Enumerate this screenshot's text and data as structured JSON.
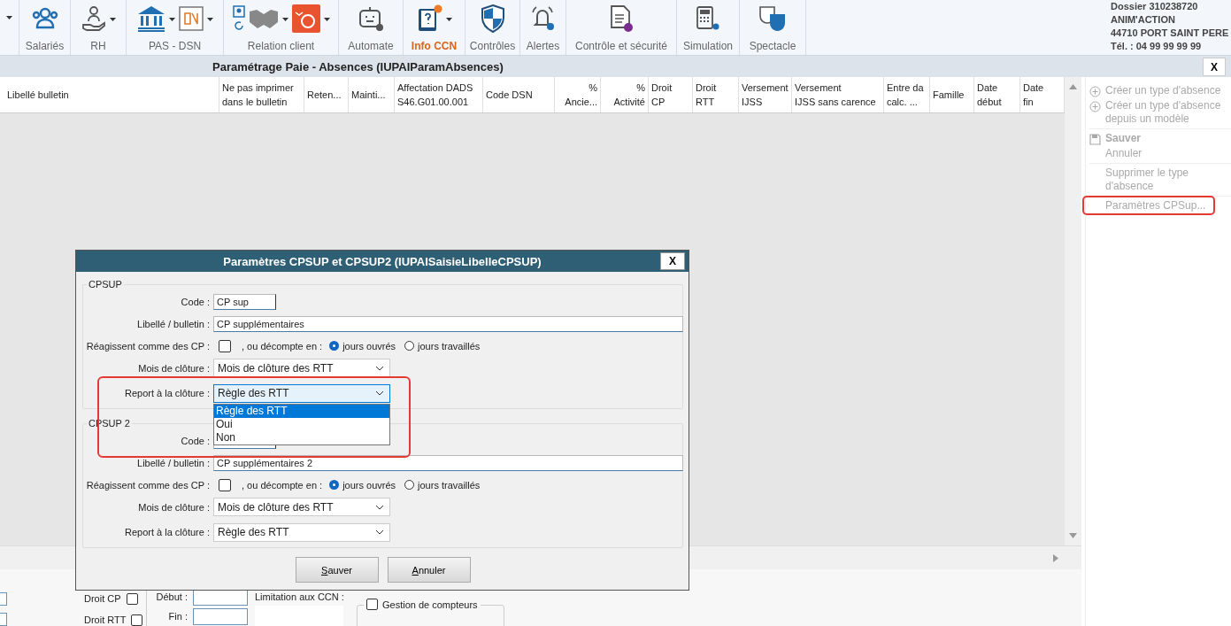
{
  "toolbar": {
    "groups": [
      {
        "label": "Salariés",
        "selected": false
      },
      {
        "label": "RH",
        "selected": false
      },
      {
        "label": "PAS - DSN",
        "selected": false
      },
      {
        "label": "Relation client",
        "selected": false
      },
      {
        "label": "Automate",
        "selected": false
      },
      {
        "label": "Info CCN",
        "selected": true
      },
      {
        "label": "Contrôles",
        "selected": false
      },
      {
        "label": "Alertes",
        "selected": false
      },
      {
        "label": "Contrôle et sécurité",
        "selected": false
      },
      {
        "label": "Simulation",
        "selected": false
      },
      {
        "label": "Spectacle",
        "selected": false
      }
    ],
    "dossier": [
      "Dossier 310238720",
      "ANIM'ACTION",
      "44710 PORT SAINT PERE",
      "Tél. : 04 99 99 99 99"
    ]
  },
  "window": {
    "title": "Paramétrage Paie - Absences (IUPAIParamAbsences)",
    "close": "X"
  },
  "table": {
    "columns": [
      "Libellé bulletin",
      "Ne pas imprimer\ndans le bulletin",
      "Reten...",
      "Mainti...",
      "Affectation DADS\nS46.G01.00.001",
      "Code DSN",
      "%\nAncie...",
      "%\nActivité",
      "Droit\nCP",
      "Droit\nRTT",
      "Versement\nIJSS",
      "Versement\nIJSS sans carence",
      "Entre da\ncalc. ...",
      "Famille",
      "Date\ndébut",
      "Date\nfin"
    ]
  },
  "sidebar": {
    "groups": [
      [
        {
          "label": "Créer un type d'absence",
          "kind": "create",
          "disabled": true,
          "highlighted": false
        },
        {
          "label": "Créer un type d'absence depuis un modèle",
          "kind": "create",
          "disabled": true,
          "highlighted": false
        }
      ],
      [
        {
          "label": "Sauver",
          "kind": "save",
          "disabled": true,
          "highlighted": false
        },
        {
          "label": "Annuler",
          "kind": "plain",
          "disabled": true,
          "highlighted": false
        }
      ],
      [
        {
          "label": "Supprimer le type d'absence",
          "kind": "plain",
          "disabled": true,
          "highlighted": false
        }
      ],
      [
        {
          "label": "Paramètres CPSup...",
          "kind": "plain",
          "disabled": true,
          "highlighted": true
        }
      ]
    ]
  },
  "dialog": {
    "title": "Paramètres CPSUP et CPSUP2 (IUPAISaisieLibelleCPSUP)",
    "close": "X",
    "sections": [
      {
        "legend": "CPSUP",
        "code_label": "Code :",
        "code_value": "CP sup",
        "libelle_label": "Libellé / bulletin :",
        "libelle_value": "CP supplémentaires",
        "react_label": "Réagissent comme des CP :",
        "react_checked": false,
        "decompte_label": ", ou décompte en :",
        "options": [
          {
            "label": "jours ouvrés",
            "selected": true
          },
          {
            "label": "jours travaillés",
            "selected": false
          }
        ],
        "mois_label": "Mois de clôture :",
        "mois_value": "Mois de clôture des RTT",
        "report_label": "Report à la clôture :",
        "report_value": "Règle des RTT",
        "report_open": true,
        "report_highlighted": true,
        "report_options": [
          {
            "label": "Règle des RTT",
            "selected": true
          },
          {
            "label": "Oui",
            "selected": false
          },
          {
            "label": "Non",
            "selected": false
          }
        ]
      },
      {
        "legend": "CPSUP 2",
        "code_label": "Code :",
        "libelle_label": "Libellé / bulletin :",
        "libelle_value": "CP supplémentaires 2",
        "react_label": "Réagissent comme des CP :",
        "react_checked": false,
        "decompte_label": ", ou décompte en :",
        "options": [
          {
            "label": "jours ouvrés",
            "selected": true
          },
          {
            "label": "jours travaillés",
            "selected": false
          }
        ],
        "mois_label": "Mois de clôture :",
        "mois_value": "Mois de clôture des RTT",
        "report_label": "Report à la clôture :",
        "report_value": "Règle des RTT",
        "report_open": false,
        "report_highlighted": false
      }
    ],
    "buttons": [
      "Sauver",
      "Annuler"
    ]
  },
  "form": {
    "droit_cp_label": "Droit CP",
    "droit_cp_checked": false,
    "droit_rtt_label": "Droit RTT",
    "droit_rtt_checked": false,
    "debut_label": "Début :",
    "fin_label": "Fin :",
    "limitation_label": "Limitation aux CCN :",
    "compteurs_label": "Gestion de compteurs",
    "compteurs_checked": false
  }
}
